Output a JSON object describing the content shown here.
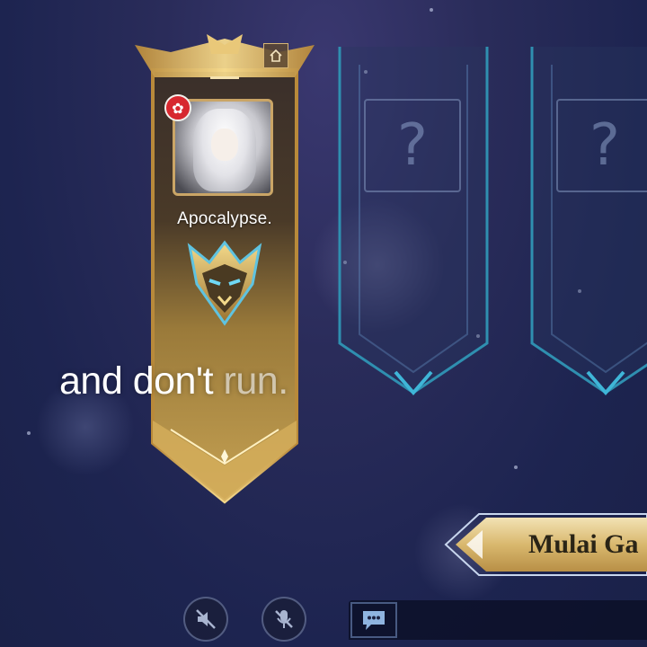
{
  "player": {
    "name": "Apocalypse.",
    "region_flag": "✿"
  },
  "empty_slots": [
    {
      "placeholder": "?"
    },
    {
      "placeholder": "?"
    }
  ],
  "subtitle": {
    "bright": "and don't ",
    "dim": "run."
  },
  "start_button": {
    "label": "Mulai Ga"
  },
  "controls": {
    "speaker": "speaker-muted-icon",
    "mic": "mic-muted-icon",
    "chat": "chat-icon"
  },
  "colors": {
    "gold": "#caa566",
    "slot_cyan": "#2f8fb0",
    "background": "#1f2750"
  }
}
